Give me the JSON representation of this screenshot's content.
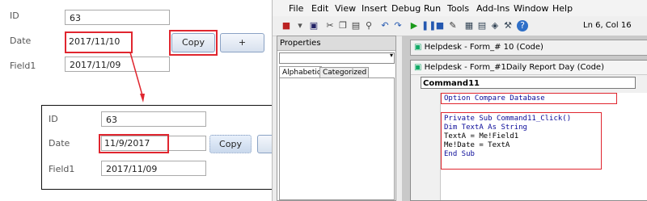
{
  "form": {
    "id_label": "ID",
    "id_value": "63",
    "date_label": "Date",
    "date_value": "2017/11/10",
    "field1_label": "Field1",
    "field1_value": "2017/11/09",
    "copy_label": "Copy",
    "plus_label": "+"
  },
  "inset_form": {
    "id_label": "ID",
    "id_value": "63",
    "date_label": "Date",
    "date_value": "11/9/2017",
    "field1_label": "Field1",
    "field1_value": "2017/11/09",
    "copy_label": "Copy",
    "plus_label": "+"
  },
  "editor": {
    "menu": [
      "File",
      "Edit",
      "View",
      "Insert",
      "Debug",
      "Run",
      "Tools",
      "Add-Ins",
      "Window",
      "Help"
    ],
    "status": "Ln 6, Col 16",
    "properties": {
      "title": "Properties",
      "tab_alphabetic": "Alphabetic",
      "tab_categorized": "Categorized"
    },
    "back_window_title": "Helpdesk - Form_# 10 (Code)",
    "code_window_title": "Helpdesk - Form_#1Daily Report Day (Code)",
    "object_dropdown": "Command11",
    "code_lines": [
      "Option Compare Database",
      "",
      "Private Sub Command11_Click()",
      "Dim TextA As String",
      "TextA = Me!Field1",
      "Me!Date = TextA",
      "End Sub"
    ]
  },
  "colors": {
    "highlight": "#e0262f",
    "keyword": "#0c0c9a"
  }
}
